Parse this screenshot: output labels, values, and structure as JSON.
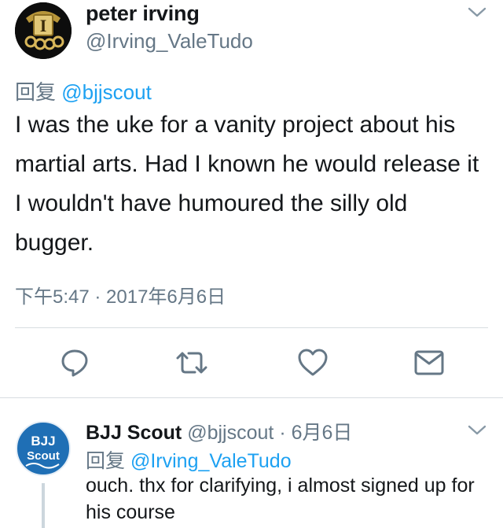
{
  "main_tweet": {
    "author_name": "peter irving",
    "author_handle": "@Irving_ValeTudo",
    "reply_prefix": "回复",
    "reply_mention": "@bjjscout",
    "text": "I was the uke for a vanity project about his martial arts. Had I known he would release it I wouldn't have humoured the silly old bugger.",
    "timestamp": "下午5:47 · 2017年6月6日",
    "avatar_logo_letter": "I",
    "actions": [
      {
        "name": "reply-icon"
      },
      {
        "name": "retweet-icon"
      },
      {
        "name": "like-icon"
      },
      {
        "name": "direct-message-icon"
      }
    ]
  },
  "reply_tweet": {
    "author_name": "BJJ Scout",
    "author_handle": "@bjjscout",
    "separator": "·",
    "date": "6月6日",
    "reply_prefix": "回复",
    "reply_mention": "@Irving_ValeTudo",
    "text": "ouch.  thx for clarifying, i almost signed up for his course",
    "avatar_logo_line1": "BJJ",
    "avatar_logo_line2": "Scout"
  },
  "colors": {
    "text_primary": "#14171a",
    "text_secondary": "#657786",
    "link": "#1da1f2",
    "divider": "#d8dde1",
    "scout_blue": "#1f6fb5"
  }
}
